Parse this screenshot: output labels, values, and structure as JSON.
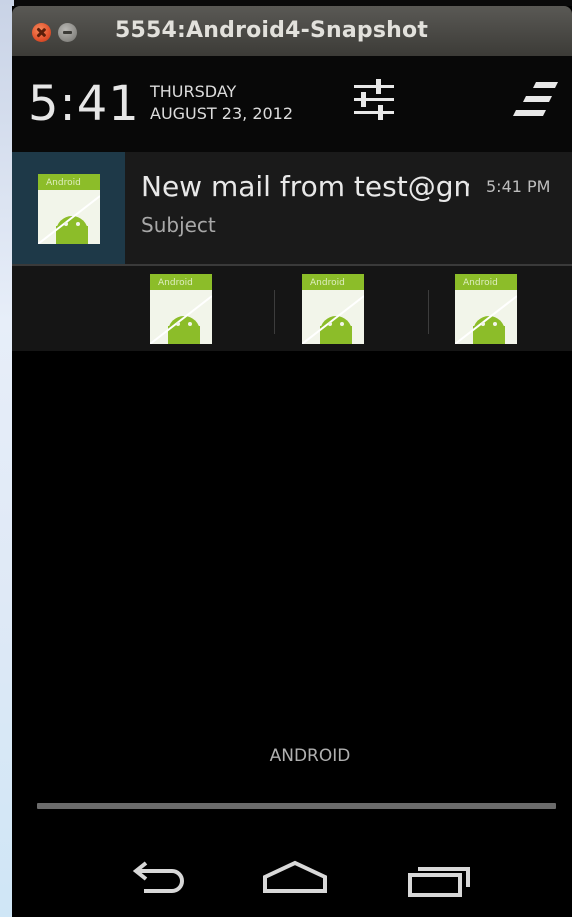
{
  "window": {
    "title": "5554:Android4-Snapshot"
  },
  "status": {
    "time": "5:41",
    "day": "THURSDAY",
    "date": "AUGUST 23, 2012"
  },
  "icons": {
    "settings": "settings-sliders-icon",
    "clear": "clear-all-icon",
    "app": "android-app-icon",
    "back": "back-icon",
    "home": "home-icon",
    "recents": "recent-apps-icon"
  },
  "notification": {
    "title": "New mail from test@gmail.com",
    "subject": "Subject",
    "time": "5:41 PM",
    "icon_label": "Android"
  },
  "carrier": "ANDROID",
  "colors": {
    "highlight": "#1e3948",
    "android_green": "#8cbd29"
  }
}
